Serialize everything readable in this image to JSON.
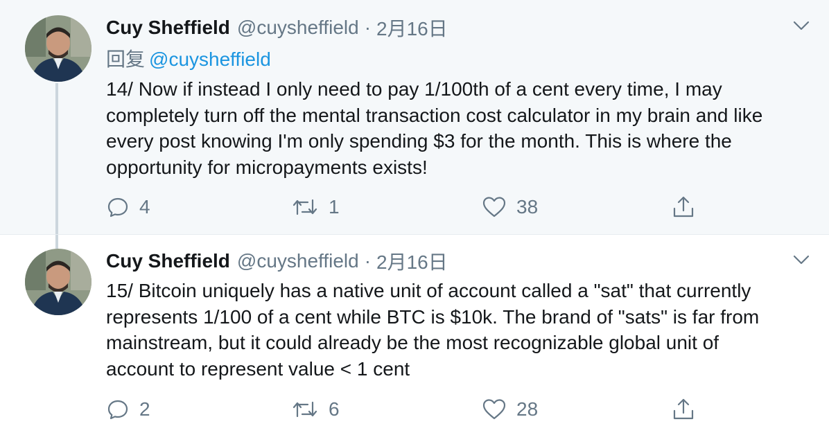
{
  "tweets": [
    {
      "name": "Cuy Sheffield",
      "handle": "@cuysheffield",
      "separator": "·",
      "date": "2月16日",
      "reply_prefix": "回复",
      "reply_to": "@cuysheffield",
      "text_lines": [
        "14/ Now if instead I only need to pay 1/100th of a cent every time, I may",
        "completely turn off the mental transaction cost calculator in my brain and like",
        "every post knowing I'm only spending $3 for the month. This is where the",
        "opportunity for micropayments exists!"
      ],
      "replies": "4",
      "retweets": "1",
      "likes": "38"
    },
    {
      "name": "Cuy Sheffield",
      "handle": "@cuysheffield",
      "separator": "·",
      "date": "2月16日",
      "text_lines": [
        "15/ Bitcoin uniquely has a native unit of account called a \"sat\" that currently",
        "represents 1/100 of a cent while BTC is $10k. The brand of \"sats\" is far from",
        "mainstream, but it could already be the most recognizable global unit of",
        "account to represent value < 1 cent"
      ],
      "replies": "2",
      "retweets": "6",
      "likes": "28"
    }
  ],
  "colors": {
    "text": "#14171a",
    "secondary": "#657786",
    "link": "#1b95e0",
    "thread_line": "#ccd6dd",
    "highlight_bg": "#f5f8fa"
  },
  "icons": [
    "chevron-down-icon",
    "reply-icon",
    "retweet-icon",
    "like-icon",
    "share-icon"
  ]
}
